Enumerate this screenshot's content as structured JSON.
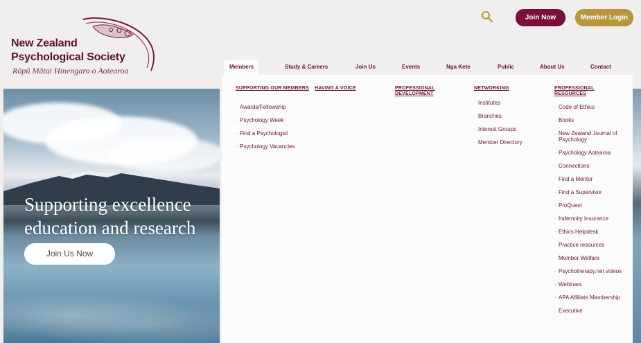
{
  "logo": {
    "line1": "New Zealand",
    "line2": "Psychological Society",
    "line3": "Rōpū Mātai Hinengaro o Aotearoa"
  },
  "header": {
    "join_label": "Join Now",
    "login_label": "Member Login",
    "search_icon": "search-icon"
  },
  "colors": {
    "maroon": "#7a0e3a",
    "gold": "#b8963c",
    "nav_text": "#6a1434"
  },
  "nav": {
    "items": [
      "Members",
      "Study & Careers",
      "Join Us",
      "Events",
      "Nga Kete",
      "Public",
      "About Us",
      "Contact"
    ],
    "active": "Members"
  },
  "hero": {
    "line1": "Supporting excellence",
    "line2": "education and research",
    "button_label": "Join Us Now"
  },
  "menu": {
    "supporting": {
      "heading": "SUPPORTING OUR MEMBERS",
      "items": [
        "Awards/Fellowship",
        "Psychology Week",
        "Find a Psychologist",
        "Psychology Vacancies"
      ]
    },
    "voice": {
      "heading": "HAVING A VOICE",
      "items": []
    },
    "development": {
      "heading": "PROFESSIONAL DEVELOPMENT",
      "items": []
    },
    "networking": {
      "heading": "NETWORKING",
      "items": [
        "Institutes",
        "Branches",
        "Interest Groups",
        "Member Directory"
      ]
    },
    "resources": {
      "heading": "PROFESSIONAL RESOURCES",
      "items": [
        "Code of Ethics",
        "Books",
        "New Zealand Journal of Psychology",
        "Psychology Aotearoa",
        "Connections",
        "Find a Mentor",
        "Find a Supervisor",
        "ProQuest",
        "Indemnity Insurance",
        "Ethics Helpdesk",
        "Practice resources",
        "Member Welfare",
        "Psychotherapy.net videos",
        "Webinars",
        "APA Affiliate Membership",
        "Executive"
      ]
    }
  }
}
